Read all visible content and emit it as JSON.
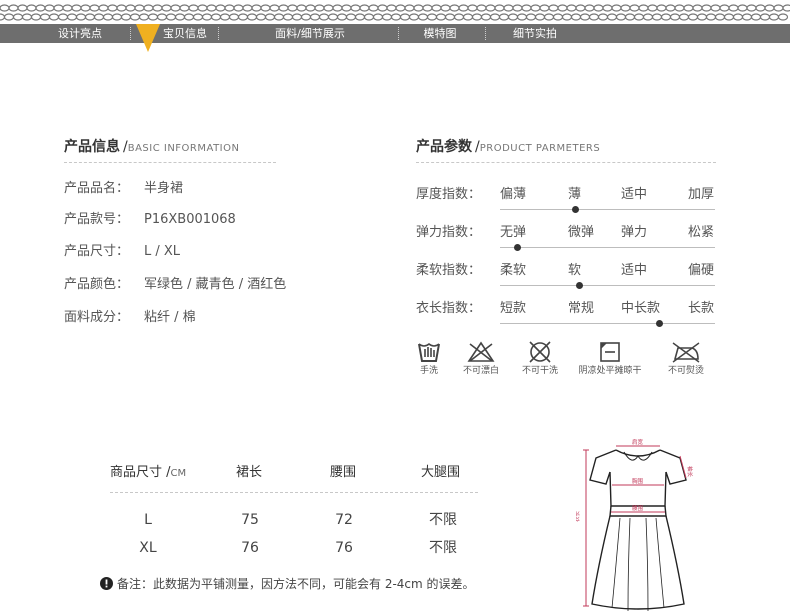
{
  "nav": {
    "items": [
      "设计亮点",
      "宝贝信息",
      "面料/细节展示",
      "模特图",
      "细节实拍"
    ],
    "active_index": 1
  },
  "info": {
    "title": "产品信息",
    "subtitle": "BASIC INFORMATION",
    "rows": [
      {
        "label": "产品品名：",
        "value": "半身裙"
      },
      {
        "label": "产品款号：",
        "value": "P16XB001068"
      },
      {
        "label": "产品尺寸：",
        "value": "L / XL"
      },
      {
        "label": "产品颜色：",
        "value": "军绿色 / 藏青色 / 酒红色"
      },
      {
        "label": "面料成分：",
        "value": "粘纤 / 棉"
      }
    ]
  },
  "params": {
    "title": "产品参数",
    "subtitle": "PRODUCT PARMETERS",
    "rows": [
      {
        "label": "厚度指数：",
        "options": [
          "偏薄",
          "薄",
          "适中",
          "加厚"
        ],
        "selected": 1
      },
      {
        "label": "弹力指数：",
        "options": [
          "无弹",
          "微弹",
          "弹力",
          "松紧"
        ],
        "selected": 0
      },
      {
        "label": "柔软指数：",
        "options": [
          "柔软",
          "软",
          "适中",
          "偏硬"
        ],
        "selected": 1
      },
      {
        "label": "衣长指数：",
        "options": [
          "短款",
          "常规",
          "中长款",
          "长款"
        ],
        "selected": 2
      }
    ]
  },
  "care": [
    {
      "icon": "hand-wash-icon",
      "label": "手洗"
    },
    {
      "icon": "no-bleach-icon",
      "label": "不可漂白"
    },
    {
      "icon": "no-dry-clean-icon",
      "label": "不可干洗"
    },
    {
      "icon": "dry-flat-shade-icon",
      "label": "阴凉处平摊晾干"
    },
    {
      "icon": "no-iron-icon",
      "label": "不可熨烫"
    }
  ],
  "size_table": {
    "headers": [
      "商品尺寸 /",
      "裙长",
      "腰围",
      "大腿围"
    ],
    "unit": "CM",
    "rows": [
      [
        "L",
        "75",
        "72",
        "不限"
      ],
      [
        "XL",
        "76",
        "76",
        "不限"
      ]
    ],
    "note": "备注：此数据为平铺测量，因方法不同，可能会有 2-4cm 的误差。"
  },
  "diagram": {
    "labels": [
      "肩宽",
      "胸围",
      "腰围",
      "袖长",
      "衣长"
    ]
  },
  "colors": {
    "nav_bg": "#6e6e6e",
    "marker": "#f0b020",
    "measure": "#c23a5a"
  }
}
